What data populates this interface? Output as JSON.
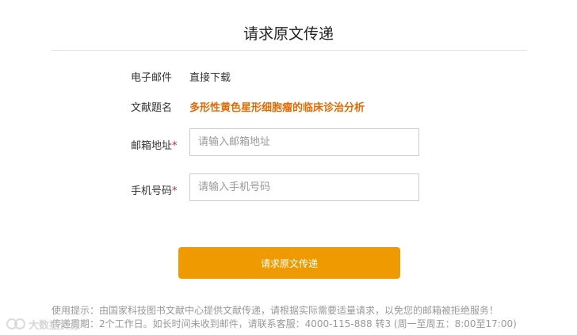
{
  "page": {
    "title": "请求原文传递"
  },
  "form": {
    "email_row": {
      "label": "电子邮件",
      "value": "直接下载"
    },
    "doc_row": {
      "label": "文献题名",
      "value": "多形性黄色星形细胞瘤的临床诊治分析"
    },
    "mailbox": {
      "label": "邮箱地址",
      "required_mark": "*",
      "placeholder": "请输入邮箱地址"
    },
    "phone": {
      "label": "手机号码",
      "required_mark": "*",
      "placeholder": "请输入手机号码"
    },
    "submit_label": "请求原文传递"
  },
  "tips": {
    "line1": "使用提示：由国家科技图书文献中心提供文献传递，请根据实际需要适量请求，以免您的邮箱被拒绝服务！",
    "line2": "传递周期：2个工作日。如长时间未收到邮件，请联系客服：4000-115-888 转3 (周一至周五：8:00至17:00)"
  },
  "watermark": {
    "text": "大数据资源"
  },
  "colors": {
    "accent": "#ef9b00",
    "doc_title": "#e26a00",
    "required": "#e02020"
  }
}
